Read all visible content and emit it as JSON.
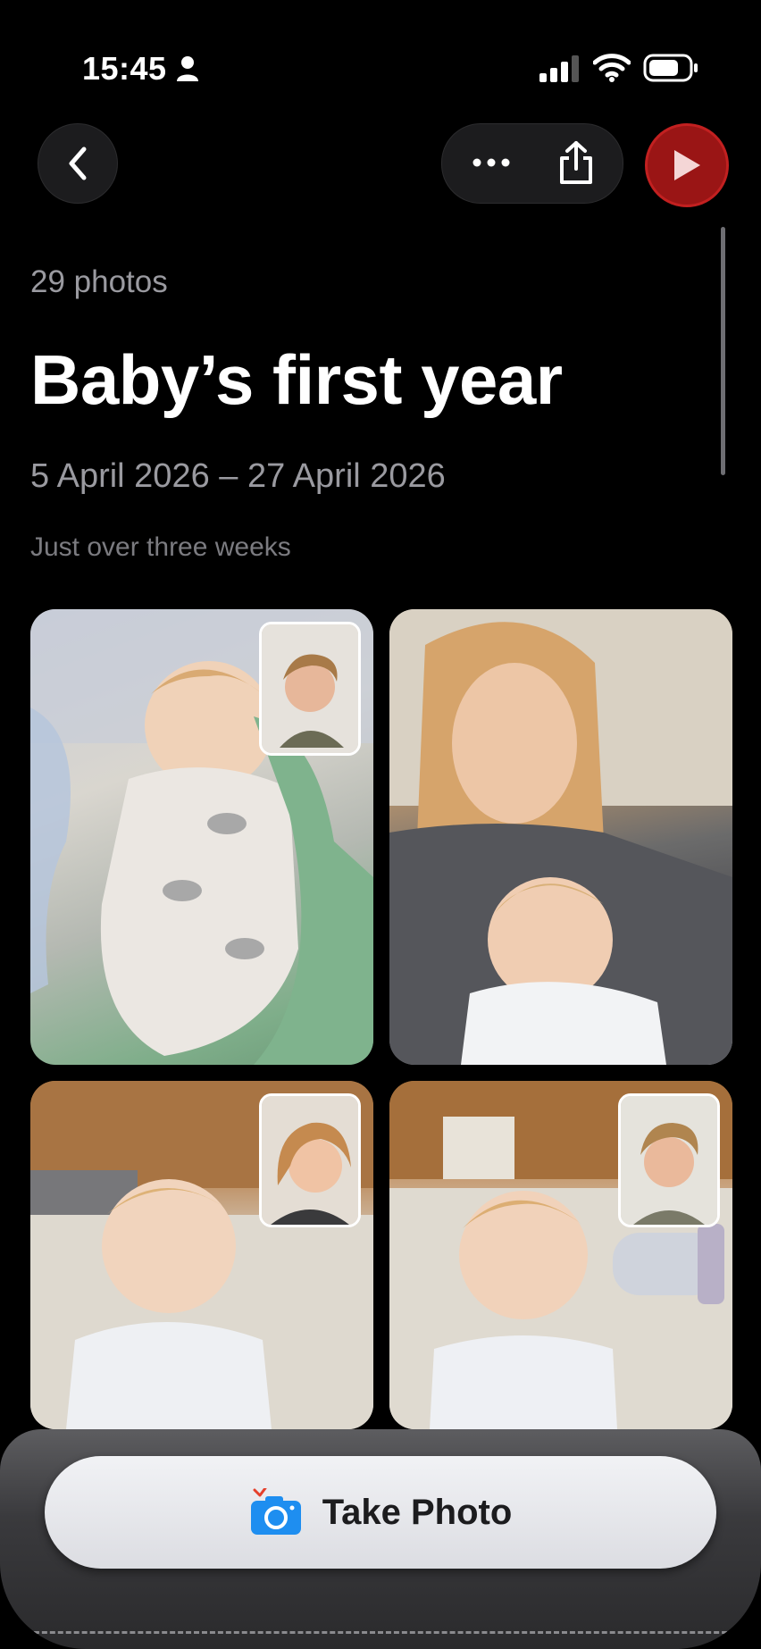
{
  "status_bar": {
    "time": "15:45"
  },
  "album": {
    "count": "29 photos",
    "title": "Baby’s first year",
    "date_range": "5 April 2026 – 27 April 2026",
    "duration": "Just over three weeks"
  },
  "photos": [
    {
      "description": "baby-sleeping-swaddled",
      "has_selfie_inset": true
    },
    {
      "description": "mother-holding-baby",
      "has_selfie_inset": false
    },
    {
      "description": "baby-sleeping-on-pillow",
      "has_selfie_inset": true
    },
    {
      "description": "baby-feeding-bottle",
      "has_selfie_inset": true
    }
  ],
  "bottom": {
    "take_photo_label": "Take Photo"
  },
  "colors": {
    "background": "#000000",
    "play_button": "#9a1515",
    "camera_icon": "#1e8ef0",
    "secondary_text": "#9a9aa0"
  },
  "icons": [
    "person-icon",
    "cellular-icon",
    "wifi-icon",
    "battery-icon",
    "chevron-left-icon",
    "more-icon",
    "share-icon",
    "play-icon",
    "camera-icon"
  ]
}
